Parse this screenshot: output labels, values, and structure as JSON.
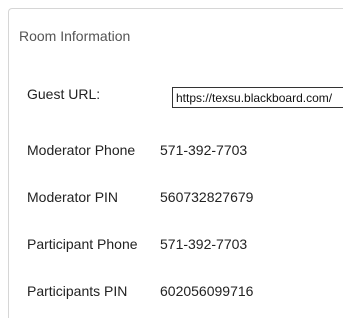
{
  "panel": {
    "title": "Room Information"
  },
  "guest_url": {
    "label": "Guest URL:",
    "value": "https://texsu.blackboard.com/"
  },
  "moderator_phone": {
    "label": "Moderator Phone",
    "value": "571-392-7703"
  },
  "moderator_pin": {
    "label": "Moderator PIN",
    "value": "560732827679"
  },
  "participant_phone": {
    "label": "Participant Phone",
    "value": "571-392-7703"
  },
  "participants_pin": {
    "label": "Participants PIN",
    "value": "602056099716"
  }
}
